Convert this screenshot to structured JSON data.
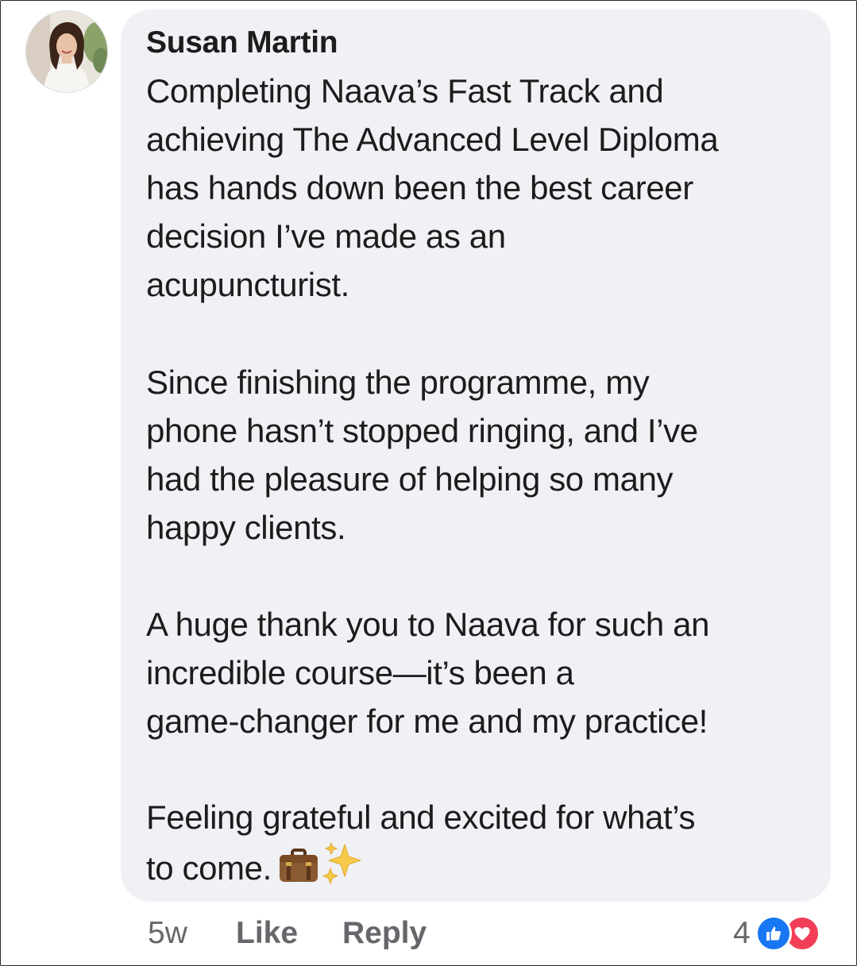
{
  "comment": {
    "author": "Susan Martin",
    "paragraphs": [
      "Completing Naava’s Fast Track and\nachieving The Advanced Level Diploma\nhas hands down been the best career\ndecision I’ve made as an\nacupuncturist.",
      "Since finishing the programme, my\nphone hasn’t stopped ringing, and I’ve\nhad the pleasure of helping so many\nhappy clients.",
      "A huge thank you to Naava for such an\nincredible course—it’s been a\ngame-changer for me and my practice!",
      "Feeling grateful and excited for what’s\nto come."
    ],
    "emojis": [
      "briefcase-emoji",
      "sparkles-emoji"
    ]
  },
  "actions": {
    "timestamp": "5w",
    "like_label": "Like",
    "reply_label": "Reply"
  },
  "reactions": {
    "count": "4",
    "icons": [
      "like-reaction-icon",
      "love-reaction-icon"
    ],
    "like_color": "#1877f2",
    "love_color": "#f33e58"
  },
  "colors": {
    "bubble": "#f0f1f5",
    "text": "#1c1c1c",
    "muted": "#65676b"
  }
}
